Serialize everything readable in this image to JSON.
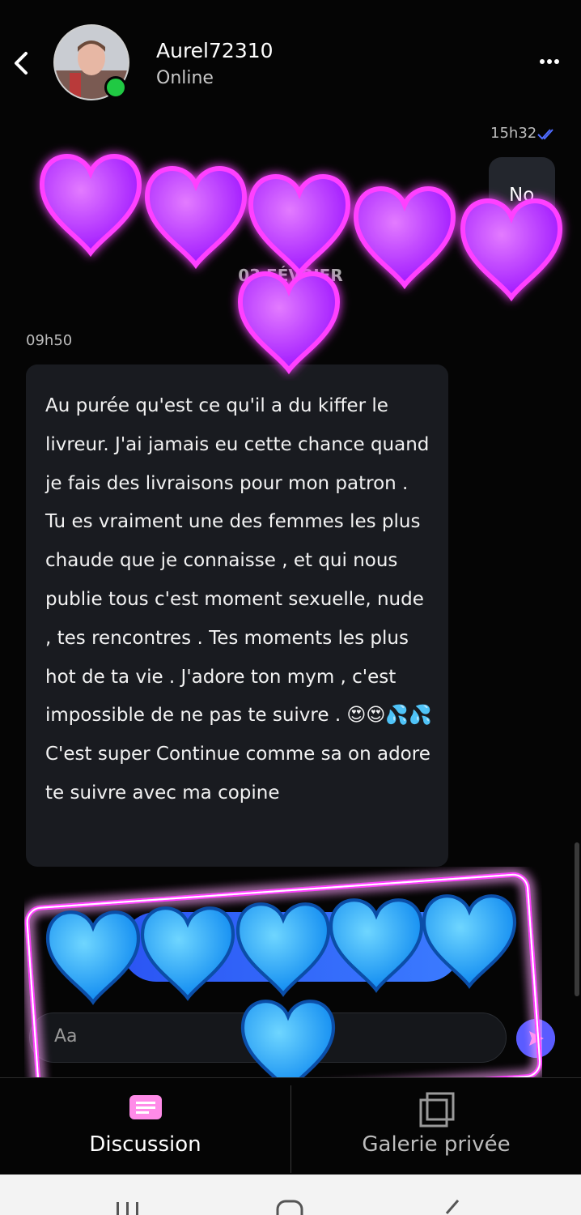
{
  "header": {
    "username": "Aurel72310",
    "status": "Online",
    "back_icon": "chevron-left-icon",
    "more_icon": "more-horizontal-icon"
  },
  "messages": {
    "outgoing": {
      "time": "15h32",
      "text": "No",
      "read_icon": "double-check-icon"
    },
    "date_separator": "03 FÉVRIER",
    "incoming": {
      "time": "09h50",
      "text": "Au purée qu'est ce qu'il a du kiffer le livreur. J'ai jamais eu cette chance quand je fais des livraisons pour mon patron . Tu es vraiment une des femmes les plus chaude que je connaisse , et qui nous publie tous c'est moment sexuelle, nude , tes rencontres . Tes moments les plus hot de ta vie . J'adore ton mym , c'est impossible de ne pas te suivre . 😍😍💦💦 C'est super Continue comme sa on adore te suivre avec ma copine"
    }
  },
  "composer": {
    "placeholder": "Aa",
    "send_icon": "send-icon"
  },
  "bottom_nav": {
    "tabs": [
      {
        "label": "Discussion",
        "icon": "chat-icon",
        "active": true
      },
      {
        "label": "Galerie privée",
        "icon": "gallery-icon",
        "active": false
      }
    ]
  },
  "colors": {
    "background": "#050505",
    "bubble_incoming": "#191b20",
    "bubble_outgoing": "#23262d",
    "online": "#20c943",
    "accent_blue": "#3b6cff",
    "sticker_purple": "#b21cff",
    "sticker_blue": "#1aa3ff",
    "neon_pink": "#ff3cff"
  },
  "system_nav": {
    "recent_icon": "recent-apps-icon",
    "home_icon": "home-icon",
    "back_icon": "system-back-icon"
  }
}
